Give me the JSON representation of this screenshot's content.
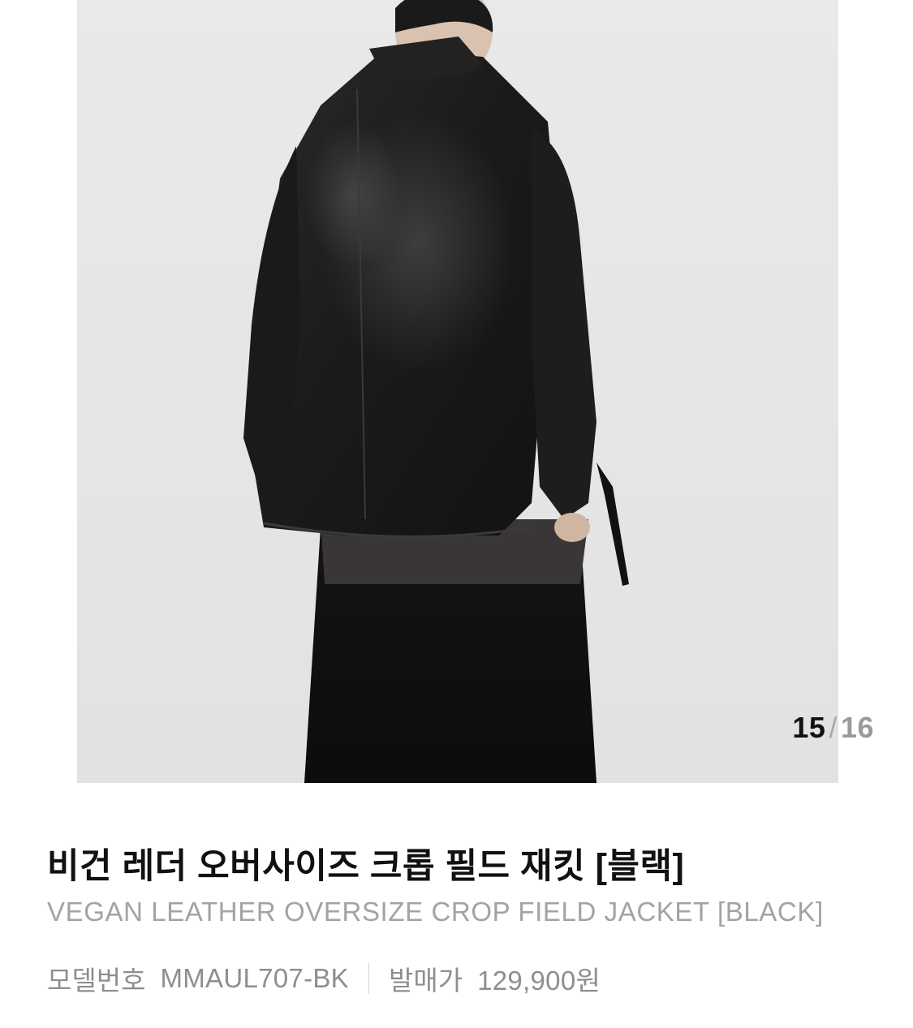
{
  "gallery": {
    "image_alt": "model wearing black vegan leather oversize crop field jacket, back view",
    "current": "15",
    "separator": "/",
    "total": "16"
  },
  "product": {
    "name_ko": "비건 레더 오버사이즈 크롭 필드 재킷 [블랙]",
    "name_en": "VEGAN LEATHER OVERSIZE CROP FIELD JACKET [BLACK]",
    "model_label": "모델번호",
    "model_number": "MMAUL707-BK",
    "price_label": "발매가",
    "price": "129,900원"
  },
  "colors": {
    "background": "#ffffff",
    "photo_bg": "#e6e6e6",
    "title": "#111111",
    "subtitle": "#a3a3a3",
    "meta": "#8e8e8e"
  }
}
